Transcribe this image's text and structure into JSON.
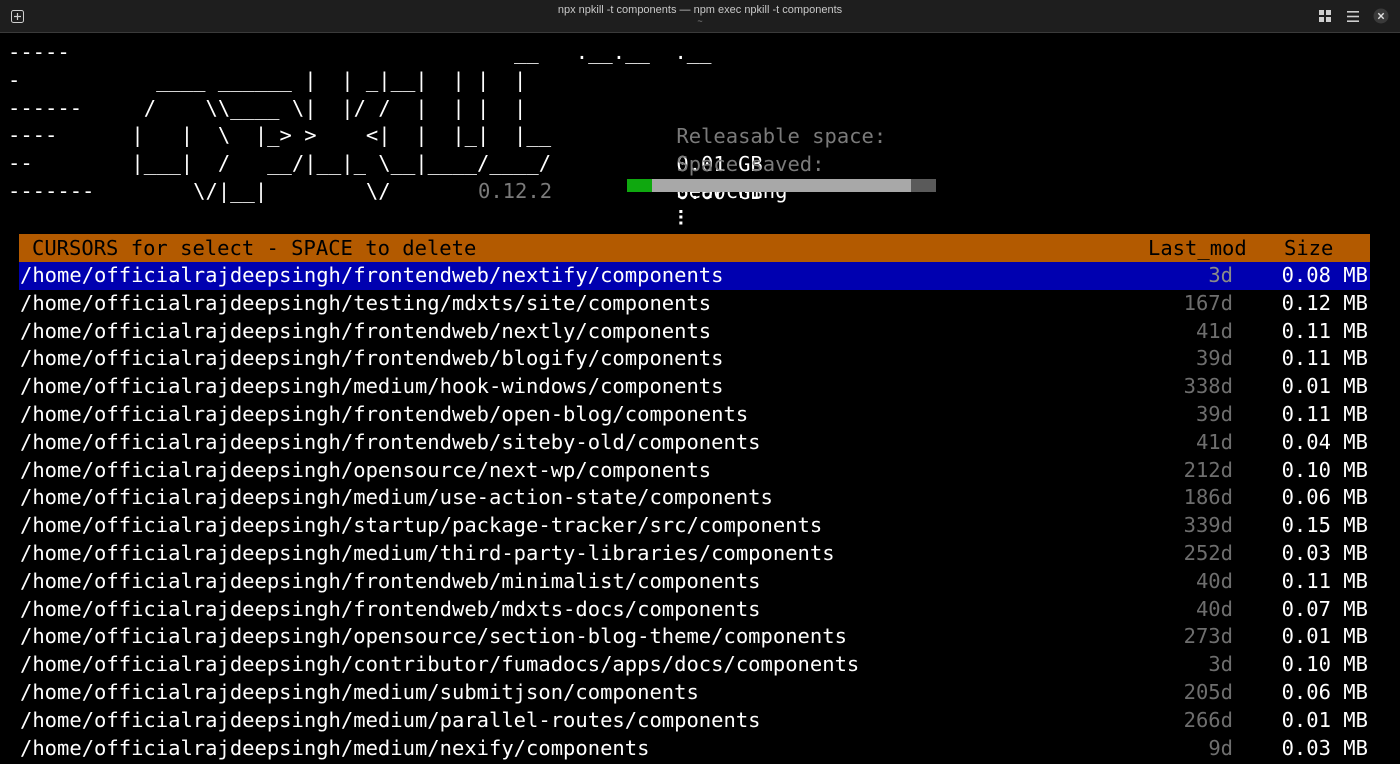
{
  "window": {
    "title": "npx npkill -t components — npm exec npkill -t components",
    "subtitle": "~"
  },
  "icons": {
    "new_tab": "new-tab-icon",
    "tiles": "tiles-icon",
    "menu": "hamburger-menu-icon",
    "close": "close-icon"
  },
  "logo": {
    "lines": [
      "-----                                    __   .__.__  .__",
      "-           ____ ______ |  | _|__|  | |  |",
      "------     /    \\\\____ \\|  |/ /  |  | |  |",
      "----      |   |  \\  |_> >    <|  |  |_|  |__",
      "--        |___|  /   __/|__|_ \\__|____/____/",
      "-------        \\/|__|        \\/"
    ],
    "version": "0.12.2"
  },
  "stats": {
    "releasable_label": "Releasable space:",
    "releasable_value": "0.01 GB",
    "saved_label": "Space saved:",
    "saved_value": "0.00 GB",
    "searching_label": "Searching",
    "spinner": "⠇",
    "progress_fraction": 0.92,
    "progress_completed_fraction": 0.08
  },
  "colors": {
    "header_bg": "#b35a00",
    "selected_bg": "#0000b0",
    "progress_green": "#0fa80f"
  },
  "table": {
    "hint": "CURSORS for select - SPACE to delete",
    "col_lastmod": "Last_mod",
    "col_size": "Size",
    "selected_index": 0,
    "rows": [
      {
        "path": "/home/officialrajdeepsingh/frontendweb/nextify/components",
        "lastmod": "3d",
        "size": "0.08 MB"
      },
      {
        "path": "/home/officialrajdeepsingh/testing/mdxts/site/components",
        "lastmod": "167d",
        "size": "0.12 MB"
      },
      {
        "path": "/home/officialrajdeepsingh/frontendweb/nextly/components",
        "lastmod": "41d",
        "size": "0.11 MB"
      },
      {
        "path": "/home/officialrajdeepsingh/frontendweb/blogify/components",
        "lastmod": "39d",
        "size": "0.11 MB"
      },
      {
        "path": "/home/officialrajdeepsingh/medium/hook-windows/components",
        "lastmod": "338d",
        "size": "0.01 MB"
      },
      {
        "path": "/home/officialrajdeepsingh/frontendweb/open-blog/components",
        "lastmod": "39d",
        "size": "0.11 MB"
      },
      {
        "path": "/home/officialrajdeepsingh/frontendweb/siteby-old/components",
        "lastmod": "41d",
        "size": "0.04 MB"
      },
      {
        "path": "/home/officialrajdeepsingh/opensource/next-wp/components",
        "lastmod": "212d",
        "size": "0.10 MB"
      },
      {
        "path": "/home/officialrajdeepsingh/medium/use-action-state/components",
        "lastmod": "186d",
        "size": "0.06 MB"
      },
      {
        "path": "/home/officialrajdeepsingh/startup/package-tracker/src/components",
        "lastmod": "339d",
        "size": "0.15 MB"
      },
      {
        "path": "/home/officialrajdeepsingh/medium/third-party-libraries/components",
        "lastmod": "252d",
        "size": "0.03 MB"
      },
      {
        "path": "/home/officialrajdeepsingh/frontendweb/minimalist/components",
        "lastmod": "40d",
        "size": "0.11 MB"
      },
      {
        "path": "/home/officialrajdeepsingh/frontendweb/mdxts-docs/components",
        "lastmod": "40d",
        "size": "0.07 MB"
      },
      {
        "path": "/home/officialrajdeepsingh/opensource/section-blog-theme/components",
        "lastmod": "273d",
        "size": "0.01 MB"
      },
      {
        "path": "/home/officialrajdeepsingh/contributor/fumadocs/apps/docs/components",
        "lastmod": "3d",
        "size": "0.10 MB"
      },
      {
        "path": "/home/officialrajdeepsingh/medium/submitjson/components",
        "lastmod": "205d",
        "size": "0.06 MB"
      },
      {
        "path": "/home/officialrajdeepsingh/medium/parallel-routes/components",
        "lastmod": "266d",
        "size": "0.01 MB"
      },
      {
        "path": "/home/officialrajdeepsingh/medium/nexify/components",
        "lastmod": "9d",
        "size": "0.03 MB"
      }
    ]
  }
}
